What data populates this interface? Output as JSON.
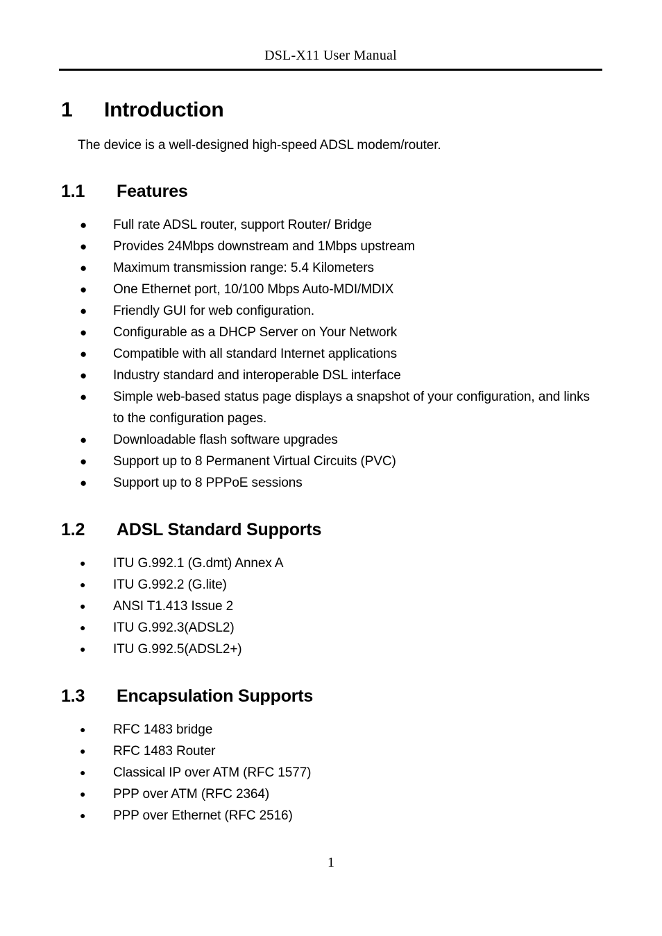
{
  "document": {
    "header_title": "DSL-X11 User Manual",
    "page_number": "1",
    "bullet_glyph": "●"
  },
  "chapter": {
    "number": "1",
    "title": "Introduction",
    "intro_paragraph": "The device is a well-designed high-speed ADSL modem/router."
  },
  "sections": [
    {
      "number": "1.1",
      "title": "Features",
      "items": [
        "Full rate ADSL router, support Router/ Bridge",
        "Provides 24Mbps downstream and 1Mbps upstream",
        "Maximum transmission range: 5.4 Kilometers",
        "One Ethernet port, 10/100 Mbps Auto-MDI/MDIX",
        "Friendly GUI for web configuration.",
        "Configurable as a DHCP Server on Your Network",
        "Compatible with all standard Internet applications",
        "Industry standard and interoperable DSL interface",
        "Simple web-based status page displays a snapshot of your configuration, and links to the configuration pages.",
        "Downloadable flash software upgrades",
        "Support up to 8 Permanent Virtual Circuits (PVC)",
        "Support up to 8 PPPoE sessions"
      ]
    },
    {
      "number": "1.2",
      "title": "ADSL Standard Supports",
      "items": [
        "ITU G.992.1 (G.dmt) Annex A",
        "ITU G.992.2 (G.lite)",
        "ANSI T1.413 Issue 2",
        "ITU G.992.3(ADSL2)",
        "ITU G.992.5(ADSL2+)"
      ]
    },
    {
      "number": "1.3",
      "title": "Encapsulation Supports",
      "items": [
        "RFC 1483 bridge",
        "RFC 1483 Router",
        "Classical IP over ATM (RFC 1577)",
        "PPP over ATM (RFC 2364)",
        "PPP over Ethernet (RFC 2516)"
      ]
    }
  ]
}
